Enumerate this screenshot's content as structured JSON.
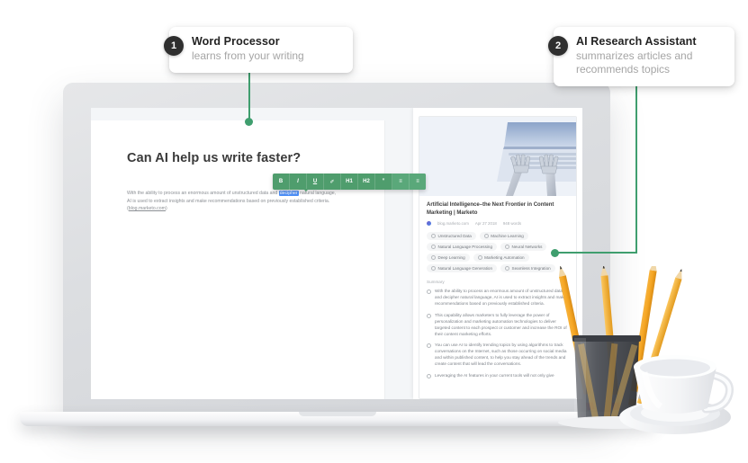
{
  "callouts": [
    {
      "number": "1",
      "title": "Word Processor",
      "subtitle": "learns from your writing"
    },
    {
      "number": "2",
      "title": "AI Research Assistant",
      "subtitle": "summarizes articles and recommends topics"
    }
  ],
  "document": {
    "title": "Can AI help us write faster?",
    "body_before": "With the ability to process an enormous amount of unstructured data and ",
    "body_highlight": "decipher",
    "body_after": " natural language, AI is used to extract insights and make recommendations based on previously established criteria. (",
    "body_link": "blog.marketo.com",
    "body_end": ")"
  },
  "toolbar": {
    "buttons": [
      {
        "name": "bold",
        "label": "B"
      },
      {
        "name": "italic",
        "label": "I"
      },
      {
        "name": "underline",
        "label": "U"
      },
      {
        "name": "link",
        "label": "✐"
      },
      {
        "name": "heading-1",
        "label": "H1"
      },
      {
        "name": "heading-2",
        "label": "H2"
      },
      {
        "name": "quote",
        "label": "”"
      },
      {
        "name": "list",
        "label": "≡"
      },
      {
        "name": "align",
        "label": "≡"
      }
    ]
  },
  "panel": {
    "article_title": "Artificial Intelligence–the Next Frontier in Content Marketing | Marketo",
    "source": "blog.marketo.com",
    "date": "Apr 27 2018",
    "word_count": "948 words",
    "hero_alt": "robot hands typing on laptop",
    "tags": [
      "Unstructured Data",
      "Machine Learning",
      "Natural Language Processing",
      "Neural Networks",
      "Deep Learning",
      "Marketing Automation",
      "Natural Language Generation",
      "Seamless Integration"
    ],
    "summary_heading": "Summary",
    "summary_bullets": [
      "With the ability to process an enormous amount of unstructured data and decipher natural language, AI is used to extract insights and make recommendations based on previously established criteria.",
      "This capability allows marketers to fully leverage the power of personalization and marketing automation technologies to deliver targeted content to each prospect or customer and increase the ROI of their content marketing efforts.",
      "You can use AI to identify trending topics by using algorithms to track conversations on the Internet, such as those occurring on social media and within published content, to help you stay ahead of the trends and create content that will lead the conversations.",
      "Leveraging the AI features in your current tools will not only give"
    ]
  },
  "colors": {
    "accent_green": "#3f9e6e",
    "toolbar_green": "#4f9d6d",
    "badge_dark": "#2f2f2f",
    "highlight_blue": "#4d8ef7"
  }
}
